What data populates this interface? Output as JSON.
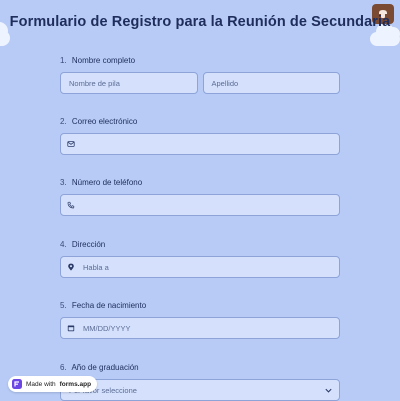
{
  "form": {
    "title": "Formulario de Registro para la Reunión de Secundaria"
  },
  "questions": [
    {
      "number": "1.",
      "label": "Nombre completo",
      "first_placeholder": "Nombre de pila",
      "last_placeholder": "Apellido"
    },
    {
      "number": "2.",
      "label": "Correo electrónico",
      "placeholder": "",
      "icon": "mail-icon"
    },
    {
      "number": "3.",
      "label": "Número de teléfono",
      "placeholder": "",
      "icon": "phone-icon"
    },
    {
      "number": "4.",
      "label": "Dirección",
      "placeholder": "Habla a",
      "icon": "location-pin-icon"
    },
    {
      "number": "5.",
      "label": "Fecha de nacimiento",
      "placeholder": "MM/DD/YYYY",
      "icon": "calendar-icon"
    },
    {
      "number": "6.",
      "label": "Año de graduación",
      "placeholder": "Por favor seleccione",
      "icon": "chevron-down-icon"
    }
  ],
  "badge": {
    "made_with": "Made with",
    "brand": "forms.app"
  },
  "colors": {
    "background": "#b7cbf6",
    "field_bg": "#d5e1fc",
    "title": "#1f2d5c",
    "theme_button": "#7a4a32"
  }
}
